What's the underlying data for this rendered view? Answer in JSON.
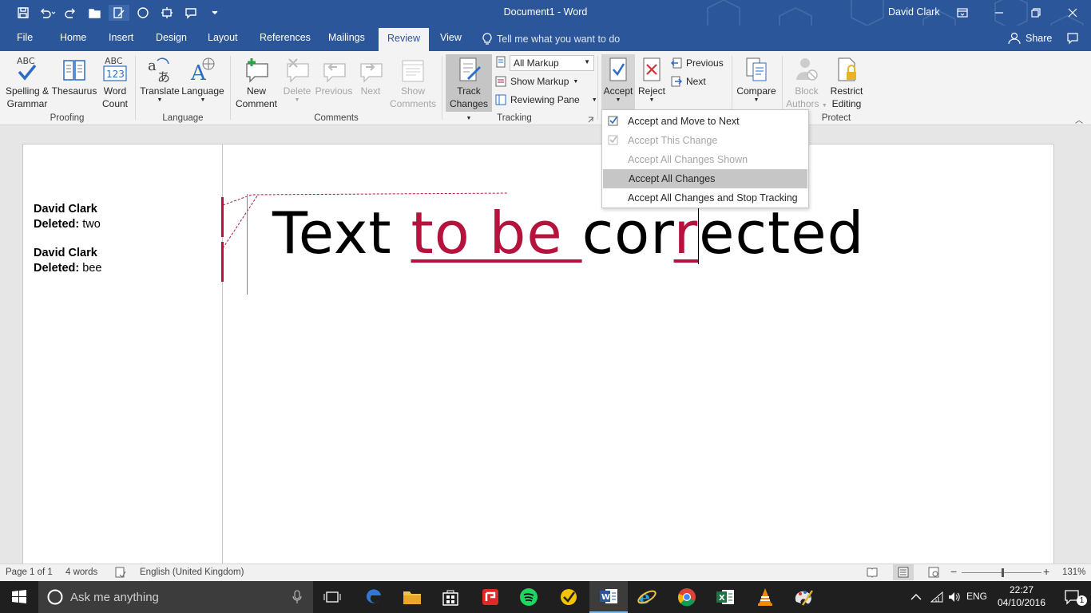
{
  "window": {
    "title": "Document1 - Word",
    "user": "David Clark"
  },
  "tabs": [
    "File",
    "Home",
    "Insert",
    "Design",
    "Layout",
    "References",
    "Mailings",
    "Review",
    "View"
  ],
  "tellme": "Tell me what you want to do",
  "share": "Share",
  "ribbon": {
    "proofing": {
      "spelling": "Spelling &",
      "spelling2": "Grammar",
      "thesaurus": "Thesaurus",
      "wordcount": "Word",
      "wordcount2": "Count",
      "group": "Proofing",
      "abc": "ABC",
      "abc123": "123"
    },
    "language": {
      "translate": "Translate",
      "language": "Language",
      "group": "Language"
    },
    "comments": {
      "new": "New",
      "new2": "Comment",
      "delete": "Delete",
      "previous": "Previous",
      "next": "Next",
      "show": "Show",
      "show2": "Comments",
      "group": "Comments"
    },
    "tracking": {
      "track": "Track",
      "track2": "Changes",
      "markup_select": "All Markup",
      "show_markup": "Show Markup",
      "reviewing_pane": "Reviewing Pane",
      "group": "Tracking"
    },
    "changes": {
      "accept": "Accept",
      "reject": "Reject",
      "previous": "Previous",
      "next": "Next"
    },
    "compare": {
      "label": "Compare"
    },
    "protect": {
      "block": "Block",
      "block2": "Authors",
      "restrict": "Restrict",
      "restrict2": "Editing",
      "group": "Protect"
    }
  },
  "accept_menu": [
    {
      "label": "Accept and Move to Next",
      "disabled": false,
      "checked": true
    },
    {
      "label": "Accept This Change",
      "disabled": true,
      "checked": true
    },
    {
      "label": "Accept All Changes Shown",
      "disabled": true,
      "checked": false
    },
    {
      "label": "Accept All Changes",
      "disabled": false,
      "checked": false,
      "highlighted": true
    },
    {
      "label": "Accept All Changes and Stop Tracking",
      "disabled": false,
      "checked": false
    }
  ],
  "markup_balloons": [
    {
      "author": "David Clark",
      "action": "Deleted:",
      "text": "two"
    },
    {
      "author": "David Clark",
      "action": "Deleted:",
      "text": "bee"
    }
  ],
  "document": {
    "t1": "Text ",
    "t2": "to be ",
    "t3": "cor",
    "t4": "r",
    "t5": "ected"
  },
  "status": {
    "page": "Page 1 of 1",
    "words": "4 words",
    "language": "English (United Kingdom)",
    "zoom": "131%"
  },
  "taskbar": {
    "search_placeholder": "Ask me anything",
    "lang": "ENG",
    "time": "22:27",
    "date": "04/10/2016",
    "notifications": "1"
  },
  "colors": {
    "brand": "#2b579a",
    "revision": "#b5123e"
  }
}
